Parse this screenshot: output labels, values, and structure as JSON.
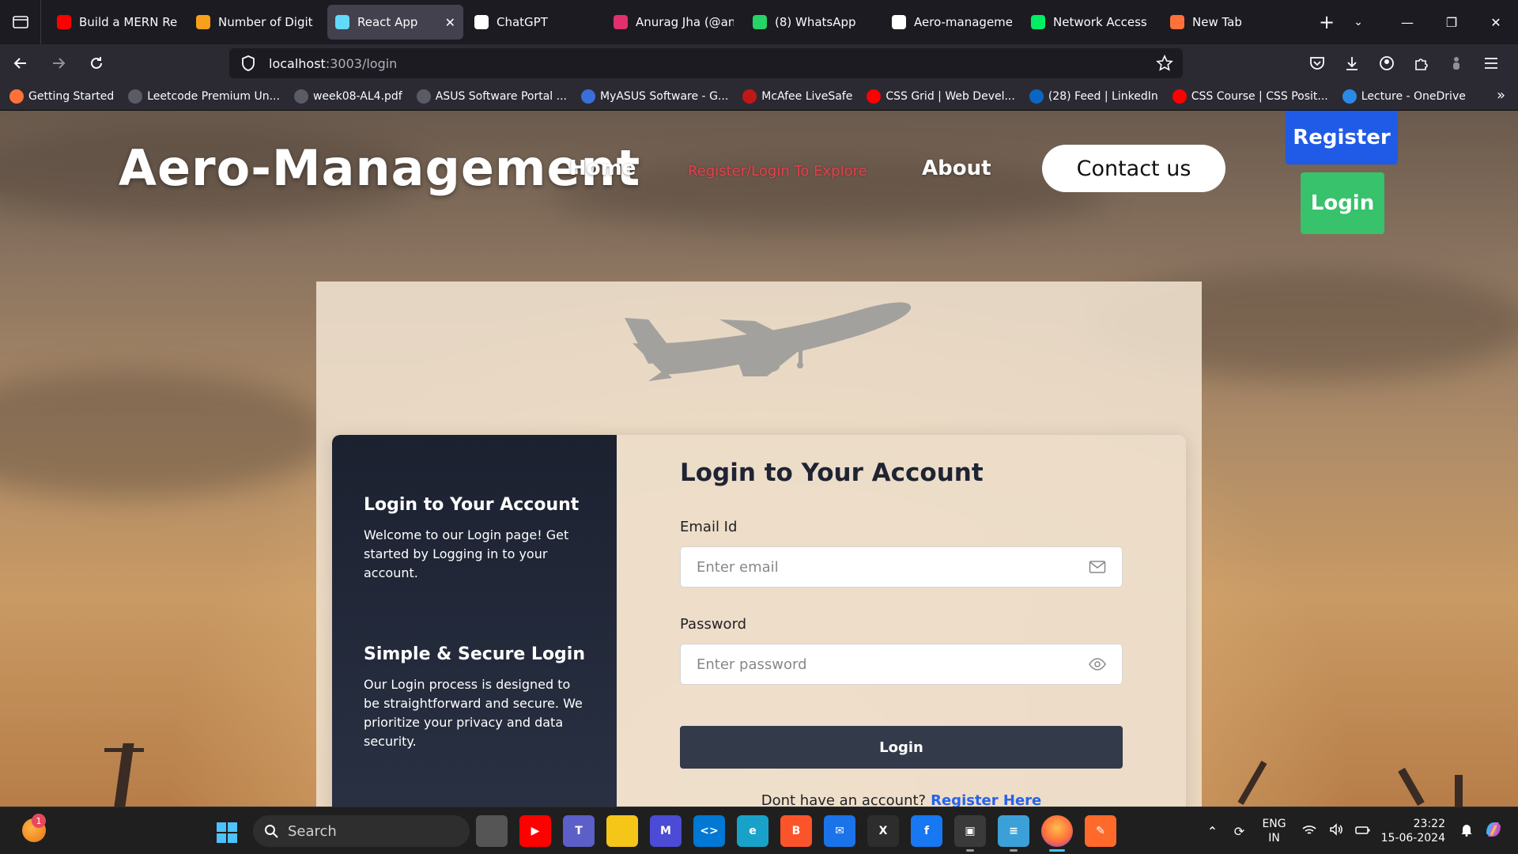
{
  "browser": {
    "tabs": [
      {
        "label": "Build a MERN Rea",
        "icon": "youtube-icon",
        "color": "#ff0000",
        "active": false
      },
      {
        "label": "Number of Digit",
        "icon": "code-icon",
        "color": "#f89f1b",
        "active": false
      },
      {
        "label": "React App",
        "icon": "react-icon",
        "color": "#61dafb",
        "active": true
      },
      {
        "label": "ChatGPT",
        "icon": "chatgpt-icon",
        "color": "#ffffff",
        "active": false
      },
      {
        "label": "Anurag Jha (@anu",
        "icon": "instagram-icon",
        "color": "#e1306c",
        "active": false
      },
      {
        "label": "(8) WhatsApp",
        "icon": "whatsapp-icon",
        "color": "#25d366",
        "active": false
      },
      {
        "label": "Aero-managemen",
        "icon": "github-icon",
        "color": "#ffffff",
        "active": false
      },
      {
        "label": "Network Access |",
        "icon": "mongodb-icon",
        "color": "#00ed64",
        "active": false
      },
      {
        "label": "New Tab",
        "icon": "firefox-icon",
        "color": "#ff7139",
        "active": false
      }
    ],
    "url_host": "localhost",
    "url_path": ":3003/login",
    "bookmarks": [
      {
        "label": "Getting Started",
        "icon": "firefox-icon",
        "color": "#ff7139"
      },
      {
        "label": "Leetcode Premium Un...",
        "icon": "globe-icon",
        "color": "#5b5b66"
      },
      {
        "label": "week08-AL4.pdf",
        "icon": "globe-icon",
        "color": "#5b5b66"
      },
      {
        "label": "ASUS Software Portal ...",
        "icon": "globe-icon",
        "color": "#5b5b66"
      },
      {
        "label": "MyASUS Software - G...",
        "icon": "asus-icon",
        "color": "#3b6fd8"
      },
      {
        "label": "McAfee LiveSafe",
        "icon": "mcafee-icon",
        "color": "#c01818"
      },
      {
        "label": "CSS Grid | Web Devel...",
        "icon": "youtube-icon",
        "color": "#ff0000"
      },
      {
        "label": "(28) Feed | LinkedIn",
        "icon": "linkedin-icon",
        "color": "#0a66c2"
      },
      {
        "label": "CSS Course | CSS Posit...",
        "icon": "youtube-icon",
        "color": "#ff0000"
      },
      {
        "label": "Lecture - OneDrive",
        "icon": "onedrive-icon",
        "color": "#2b8ae6"
      }
    ]
  },
  "site": {
    "title": "Aero-Management",
    "nav": {
      "home": "Home",
      "explore": "Register/Login To Explore",
      "about": "About",
      "contact": "Contact us",
      "register": "Register",
      "login": "Login"
    },
    "info": {
      "heading1": "Login to Your Account",
      "text1": "Welcome to our Login page! Get started by Logging in to your account.",
      "heading2": "Simple & Secure Login",
      "text2": "Our Login process is designed to be straightforward and secure. We prioritize your privacy and data security."
    },
    "form": {
      "title": "Login to Your Account",
      "email_label": "Email Id",
      "email_placeholder": "Enter email",
      "email_value": "",
      "password_label": "Password",
      "password_placeholder": "Enter password",
      "password_value": "",
      "submit": "Login",
      "signup_text": "Dont have an account?",
      "signup_link": "Register Here"
    }
  },
  "taskbar": {
    "weather_badge": "1",
    "search_label": "Search",
    "apps": [
      {
        "name": "task-view-icon",
        "color": "#555555",
        "glyph": ""
      },
      {
        "name": "youtube-app-icon",
        "color": "#ff0000",
        "glyph": "▶"
      },
      {
        "name": "teams-icon",
        "color": "#5b5fc7",
        "glyph": "T"
      },
      {
        "name": "file-explorer-icon",
        "color": "#f5c518",
        "glyph": ""
      },
      {
        "name": "mathway-icon",
        "color": "#4b4bd6",
        "glyph": "M"
      },
      {
        "name": "vscode-icon",
        "color": "#0078d4",
        "glyph": "<>"
      },
      {
        "name": "edge-icon",
        "color": "#18a2c9",
        "glyph": "e"
      },
      {
        "name": "brave-icon",
        "color": "#fb542b",
        "glyph": "B"
      },
      {
        "name": "mail-icon",
        "color": "#1a73e8",
        "glyph": "✉"
      },
      {
        "name": "xbox-icon",
        "color": "#2d2d2d",
        "glyph": "X"
      },
      {
        "name": "facebook-icon",
        "color": "#1877f2",
        "glyph": "f"
      },
      {
        "name": "app-window-icon",
        "color": "#3a3a3a",
        "glyph": "▣"
      },
      {
        "name": "notepad-icon",
        "color": "#3ba0d8",
        "glyph": "≡"
      },
      {
        "name": "firefox-taskbar-icon",
        "color": "#ff7139",
        "glyph": ""
      },
      {
        "name": "pen-app-icon",
        "color": "#ff6a2a",
        "glyph": "✎"
      }
    ],
    "lang_top": "ENG",
    "lang_bottom": "IN",
    "time": "23:22",
    "date": "15-06-2024"
  }
}
